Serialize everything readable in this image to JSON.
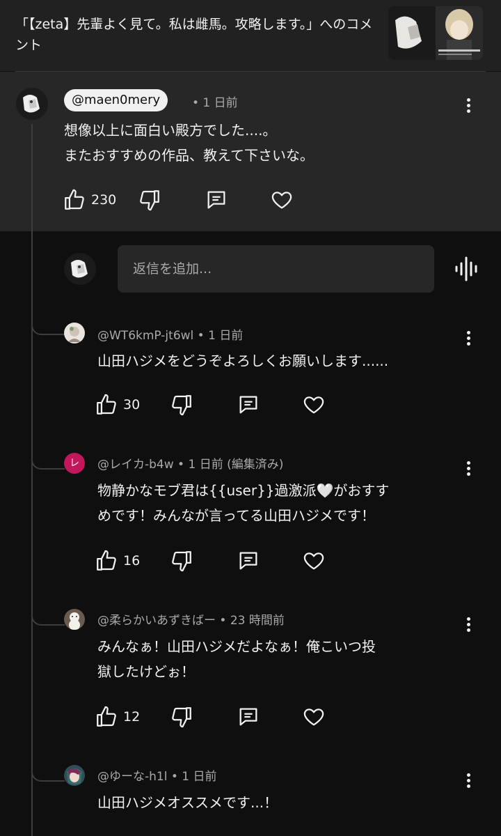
{
  "header": {
    "title": "「【zeta】先輩よく見て。私は雌馬。攻略します。」へのコメント"
  },
  "main_comment": {
    "handle": "@maen0mery",
    "time": "• 1 日前",
    "text": "想像以上に面白い殿方でした....。\nまたおすすめの作品、教えて下さいな。",
    "likes": "230"
  },
  "reply_box": {
    "placeholder": "返信を追加..."
  },
  "replies": [
    {
      "meta": "@WT6kmP-jt6wl • 1 日前",
      "text": "山田ハジメをどうぞよろしくお願いします......",
      "likes": "30"
    },
    {
      "avatar_letter": "レ",
      "meta": "@レイカ-b4w • 1 日前 (編集済み)",
      "text": "物静かなモブ君は{{user}}過激派🤍がおすす\nめです！みんなが言ってる山田ハジメです！",
      "likes": "16"
    },
    {
      "meta": "@柔らかいあずきばー • 23 時間前",
      "text": "みんなぁ！山田ハジメだよなぁ！俺こいつ投\n獄したけどぉ！",
      "likes": "12"
    },
    {
      "meta": "@ゆーな-h1l • 1 日前",
      "text": "山田ハジメオススメです...！"
    }
  ],
  "icons": {
    "like": "thumbs-up-icon",
    "dislike": "thumbs-down-icon",
    "reply": "comment-icon",
    "heart": "heart-icon",
    "more": "more-vert-icon",
    "voice": "mic-waveform-icon"
  },
  "colors": {
    "background": "#0f0f0f",
    "header_bg": "#212121",
    "highlight_bg": "#272727",
    "text": "#f1f1f1",
    "muted": "#aaaaaa",
    "letter_avatar": "#c2185b"
  }
}
